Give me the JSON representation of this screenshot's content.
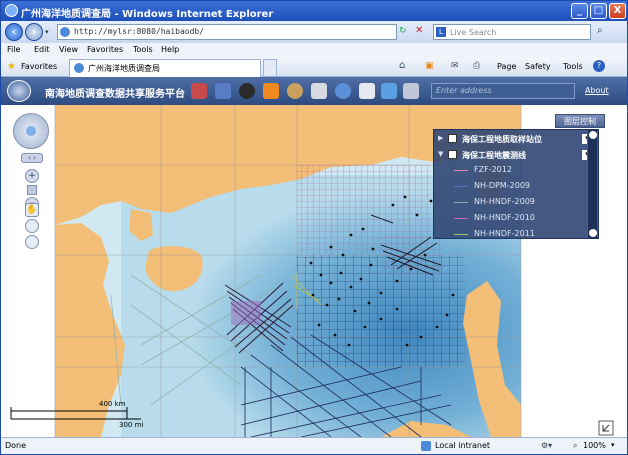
{
  "window": {
    "title": "广州海洋地质调查局 - Windows Internet Explorer",
    "buttons": [
      "_",
      "□",
      "X"
    ]
  },
  "address_bar": {
    "url": "http://mylsr:8080/haibaodb/",
    "search_placeholder": "Live Search"
  },
  "menu": [
    "File",
    "Edit",
    "View",
    "Favorites",
    "Tools",
    "Help"
  ],
  "favorites_bar": {
    "favorites_label": "Favorites",
    "tab_title": "广州海洋地质调查局",
    "tools": [
      "Page",
      "Safety",
      "Tools"
    ]
  },
  "app": {
    "title": "南海地质调查数据共享服务平台",
    "search_placeholder": "Enter address",
    "about_label": "About"
  },
  "layers": {
    "button_label": "图层控制",
    "groups": [
      {
        "label": "海保工程地质取样站位",
        "checked": true
      },
      {
        "label": "海保工程地震测线",
        "checked": true
      }
    ],
    "items": [
      {
        "label": "FZF-2012",
        "color": "#e08aa8"
      },
      {
        "label": "NH-DPM-2009",
        "color": "#5a6ec8"
      },
      {
        "label": "NH-HNDF-2009",
        "color": "#8fb0a8"
      },
      {
        "label": "NH-HNDF-2010",
        "color": "#c86ab0"
      },
      {
        "label": "NH-HNDF-2011",
        "color": "#8ac870"
      }
    ]
  },
  "scale": {
    "km_label": "400 km",
    "mi_label": "300 mi"
  },
  "status": {
    "left": "Done",
    "zone": "Local intranet",
    "zoom": "100%"
  },
  "colors": {
    "land": "#f2be78",
    "sea_shallow": "#cfe8f2",
    "sea_deep": "#6aa8cf"
  }
}
